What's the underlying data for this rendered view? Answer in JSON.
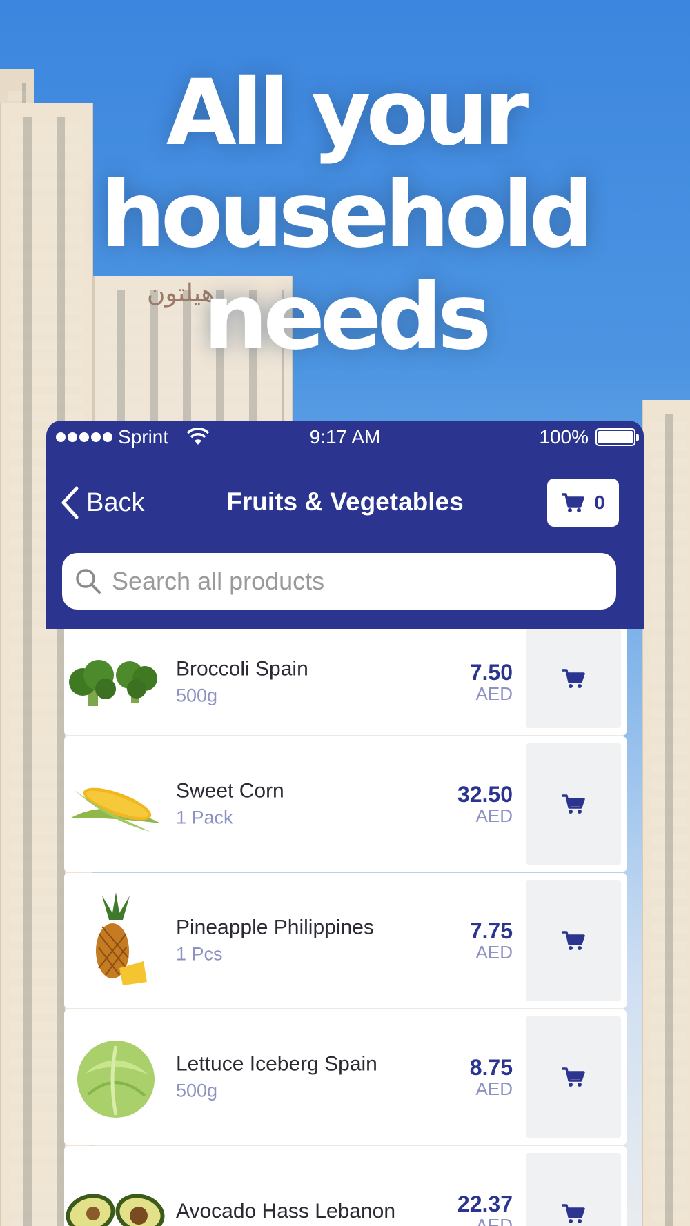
{
  "headline": {
    "line1": "All your",
    "line2": "household",
    "line3": "needs"
  },
  "status_bar": {
    "carrier": "Sprint",
    "time": "9:17 AM",
    "battery": "100%"
  },
  "nav": {
    "back_label": "Back",
    "title": "Fruits & Vegetables",
    "cart_count": "0"
  },
  "search": {
    "placeholder": "Search all products",
    "value": ""
  },
  "products": [
    {
      "name": "Broccoli Spain",
      "unit": "500g",
      "price": "7.50",
      "currency": "AED",
      "icon": "broccoli-image"
    },
    {
      "name": "Sweet Corn",
      "unit": "1 Pack",
      "price": "32.50",
      "currency": "AED",
      "icon": "corn-image"
    },
    {
      "name": "Pineapple Philippines",
      "unit": "1 Pcs",
      "price": "7.75",
      "currency": "AED",
      "icon": "pineapple-image"
    },
    {
      "name": "Lettuce Iceberg Spain",
      "unit": "500g",
      "price": "8.75",
      "currency": "AED",
      "icon": "lettuce-image"
    },
    {
      "name": "Avocado Hass Lebanon",
      "unit": "",
      "price": "22.37",
      "currency": "AED",
      "icon": "avocado-image"
    }
  ],
  "colors": {
    "brand": "#2b358f",
    "unit_text": "#8d92c3",
    "add_button_bg": "#f0f1f2"
  }
}
